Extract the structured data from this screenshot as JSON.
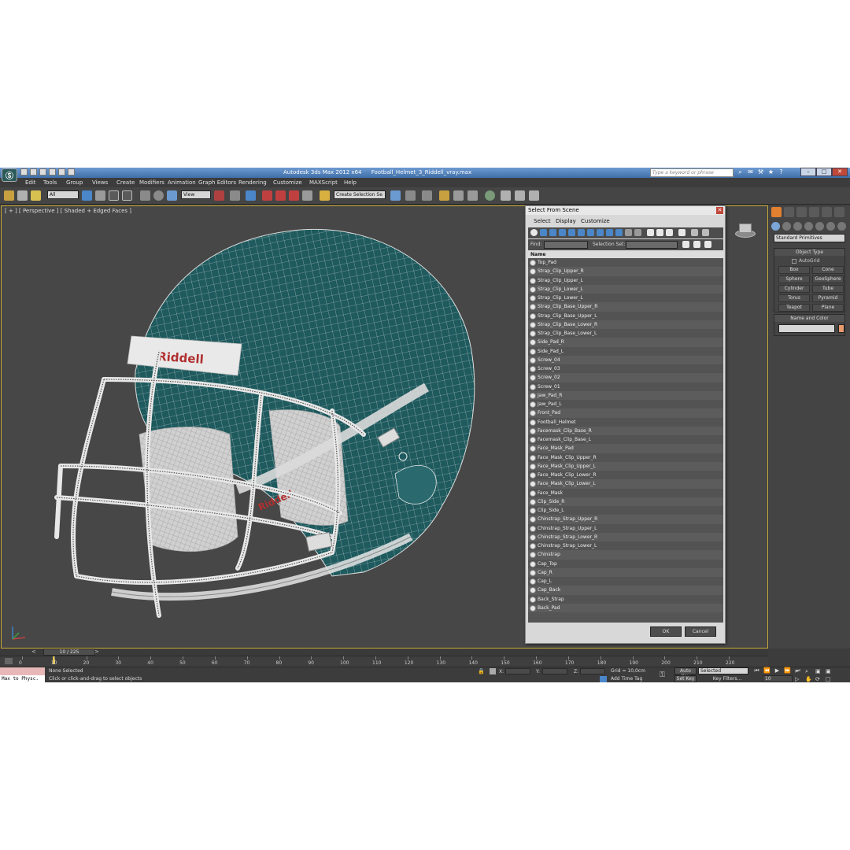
{
  "titlebar": {
    "app_title": "Autodesk 3ds Max  2012 x64",
    "file_name": "Football_Helmet_3_Riddell_vray.max",
    "search_placeholder": "Type a keyword or phrase"
  },
  "menu": [
    "Edit",
    "Tools",
    "Group",
    "Views",
    "Create",
    "Modifiers",
    "Animation",
    "Graph Editors",
    "Rendering",
    "Customize",
    "MAXScript",
    "Help"
  ],
  "toolbar": {
    "selection_filter": "All",
    "ref_coord": "View",
    "named_selection": "Create Selection Se"
  },
  "viewport": {
    "label": "[ + ] [ Perspective ] [ Shaded + Edged Faces ]",
    "logo_text": "Riddell",
    "helmet_color": "#1e5a5e",
    "wire_color": "#e6e6e6"
  },
  "dialog": {
    "title": "Select From Scene",
    "menu": [
      "Select",
      "Display",
      "Customize"
    ],
    "find_label": "Find:",
    "selection_set_label": "Selection Set:",
    "column_header": "Name",
    "items": [
      "Top_Pad",
      "Strap_Clip_Upper_R",
      "Strap_Clip_Upper_L",
      "Strap_Clip_Lower_L",
      "Strap_Clip_Lower_L",
      "Strap_Clip_Base_Upper_R",
      "Strap_Clip_Base_Upper_L",
      "Strap_Clip_Base_Lower_R",
      "Strap_Clip_Base_Lower_L",
      "Side_Pad_R",
      "Side_Pad_L",
      "Screw_04",
      "Screw_03",
      "Screw_02",
      "Screw_01",
      "Jaw_Pad_R",
      "Jaw_Pad_L",
      "Front_Pad",
      "Football_Helmet",
      "Facemask_Clip_Base_R",
      "Facemask_Clip_Base_L",
      "Face_Mask_Pad",
      "Face_Mask_Clip_Upper_R",
      "Face_Mask_Clip_Upper_L",
      "Face_Mask_Clip_Lower_R",
      "Face_Mask_Clip_Lower_L",
      "Face_Mask",
      "Clip_Side_R",
      "Clip_Side_L",
      "Chinstrap_Strap_Upper_R",
      "Chinstrap_Strap_Upper_L",
      "Chinstrap_Strap_Lower_R",
      "Chinstrap_Strap_Lower_L",
      "Chinstrap",
      "Cap_Top",
      "Cap_R",
      "Cap_L",
      "Cap_Back",
      "Back_Strap",
      "Back_Pad"
    ],
    "ok_label": "OK",
    "cancel_label": "Cancel"
  },
  "command_panel": {
    "category": "Standard Primitives",
    "object_type_header": "Object Type",
    "autogrid_label": "AutoGrid",
    "primitives": [
      "Box",
      "Cone",
      "Sphere",
      "GeoSphere",
      "Cylinder",
      "Tube",
      "Torus",
      "Pyramid",
      "Teapot",
      "Plane"
    ],
    "name_color_header": "Name and Color",
    "object_color": "#e89a6c"
  },
  "timeline": {
    "frame_display": "10 / 225",
    "ticks": [
      "0",
      "10",
      "20",
      "30",
      "40",
      "50",
      "60",
      "70",
      "80",
      "90",
      "100",
      "110",
      "120",
      "130",
      "140",
      "150",
      "160",
      "170",
      "180",
      "190",
      "200",
      "210",
      "220"
    ]
  },
  "status": {
    "maxscript_text": "Max to Physc.",
    "selection_status": "None Selected",
    "prompt": "Click or click-and-drag to select objects",
    "x_label": "X:",
    "y_label": "Y:",
    "z_label": "Z:",
    "grid": "Grid = 10,0cm",
    "add_time_tag": "Add Time Tag",
    "auto_key": "Auto Key",
    "set_key": "Set Key",
    "key_mode": "Selected",
    "key_filters": "Key Filters...",
    "current_frame": "10"
  }
}
